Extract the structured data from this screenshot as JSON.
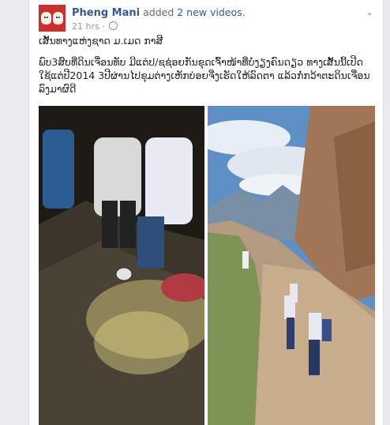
{
  "post": {
    "author": "Pheng Mani",
    "action_text": "added",
    "action_count": "2 new videos",
    "action_suffix": ".",
    "time": "21 hrs",
    "menu_icon": "chevron-down-icon",
    "title_line": "ເສັ້ນທາງແຫ່ງຊາດ ມ.ເມດ ກາສີ",
    "body": "ພົບ3ສົບທີ່ດິນເຈື່ອນທັບ ມີແຕ່ປ/ຊຊ່ອຍກັນຂຸດເຈົ້າໜ້າທີ່ບໍ່ງຽງຄົນດຽວ ທາງເສັ້ນນີ້ເປີດໃຊ້ແຕ່ປີ2014 3ປີຜ່ານໄປຂຸມຕ່າງເຫັກບ່ອຍຈີ່ງເຮັດໃຫ້ລົດຕາ ແລ້ວກໍ່ກວ້າຕະດິນເຈື່ອນລົງມາຜົດີ"
  },
  "videos": [
    {
      "kind": "video",
      "subject": "night-dig"
    },
    {
      "kind": "video",
      "subject": "mountain-road"
    }
  ]
}
